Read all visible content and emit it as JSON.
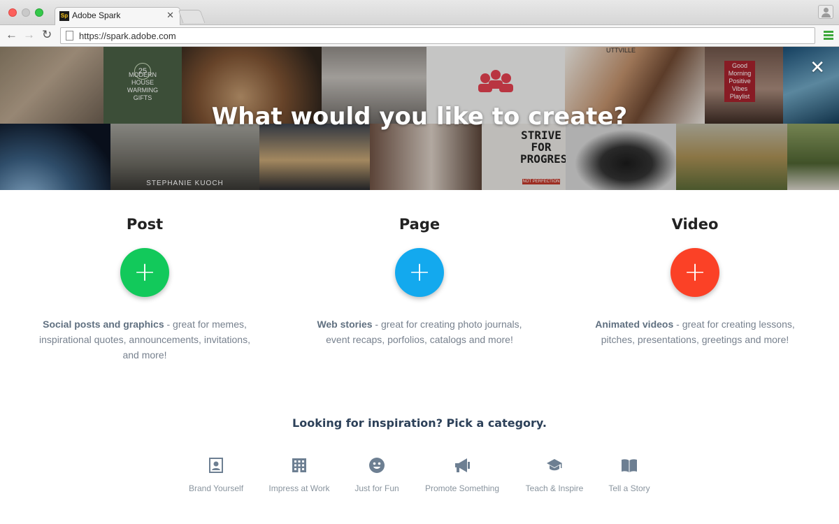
{
  "browser": {
    "tab_title": "Adobe Spark",
    "tab_favicon": "Sp",
    "url": "https://spark.adobe.com"
  },
  "hero": {
    "title": "What would you like to create?",
    "captions": {
      "modern_house": "MODERN HOUSE WARMING GIFTS",
      "modern_house_number": "25",
      "stephanie": "STEPHANIE KUOCH",
      "strive": "STRIVE FOR PROGRESS",
      "strive_sub": "NOT PERFECTION",
      "positive": "Good Morning Positive Vibes Playlist",
      "buttville": "UTTVILLE"
    }
  },
  "create": [
    {
      "title": "Post",
      "bold": "Social posts and graphics",
      "rest": " - great for memes, inspirational quotes, announcements, invitations, and more!",
      "color": "#12c95b"
    },
    {
      "title": "Page",
      "bold": "Web stories",
      "rest": " - great for creating photo journals, event recaps, porfolios, catalogs and more!",
      "color": "#13a9ee"
    },
    {
      "title": "Video",
      "bold": "Animated videos",
      "rest": " - great for creating lessons, pitches, presentations, greetings and more!",
      "color": "#fb4126"
    }
  ],
  "inspiration": {
    "heading": "Looking for inspiration? Pick a category.",
    "categories": [
      {
        "label": "Brand Yourself",
        "icon": "portrait-icon"
      },
      {
        "label": "Impress at Work",
        "icon": "building-icon"
      },
      {
        "label": "Just for Fun",
        "icon": "smiley-icon"
      },
      {
        "label": "Promote Something",
        "icon": "megaphone-icon"
      },
      {
        "label": "Teach & Inspire",
        "icon": "graduation-cap-icon"
      },
      {
        "label": "Tell a Story",
        "icon": "book-icon"
      }
    ]
  }
}
